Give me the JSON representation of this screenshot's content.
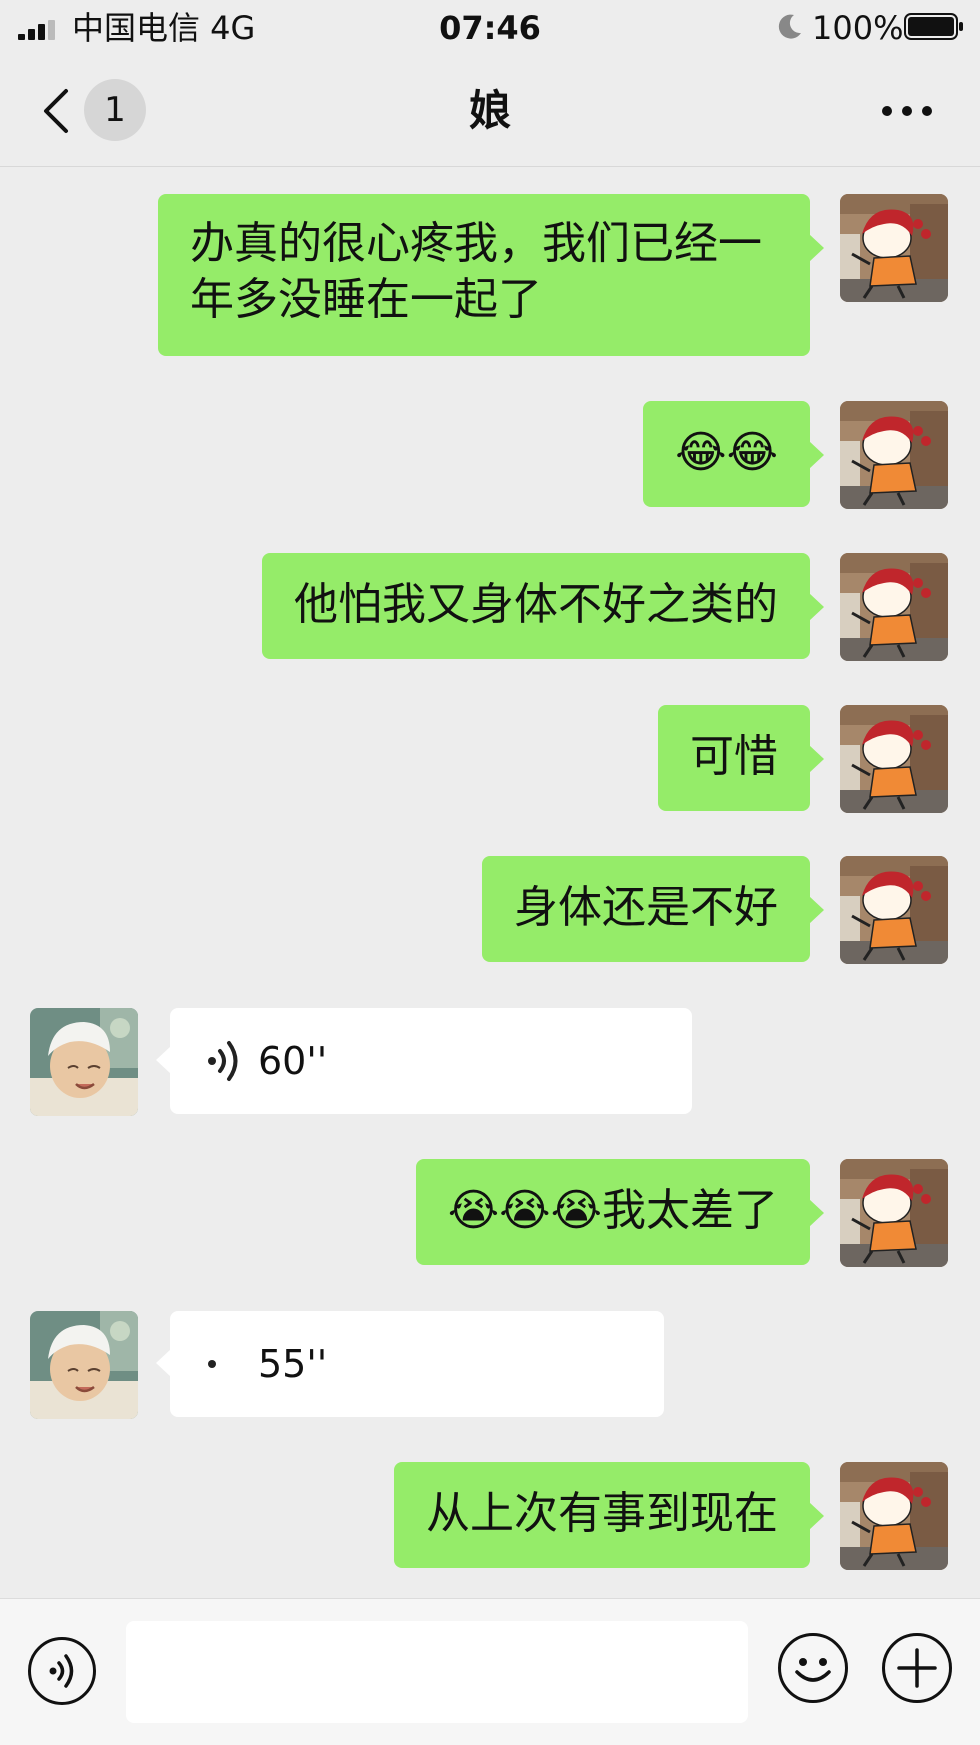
{
  "status_bar": {
    "carrier": "中国电信   4G",
    "time": "07:46",
    "battery_percent": "100%"
  },
  "nav": {
    "back_badge": "1",
    "title": "娘"
  },
  "messages": [
    {
      "side": "me",
      "type": "text",
      "text": "办真的很心疼我，我们已经一年多没睡在一起了"
    },
    {
      "side": "me",
      "type": "text",
      "text": "😂😂"
    },
    {
      "side": "me",
      "type": "text",
      "text": "他怕我又身体不好之类的"
    },
    {
      "side": "me",
      "type": "text",
      "text": "可惜"
    },
    {
      "side": "me",
      "type": "text",
      "text": "身体还是不好"
    },
    {
      "side": "other",
      "type": "voice",
      "duration": "60''"
    },
    {
      "side": "me",
      "type": "text",
      "text": "😭😭😭我太差了"
    },
    {
      "side": "other",
      "type": "voice",
      "duration": "55''"
    },
    {
      "side": "me",
      "type": "text",
      "text": "从上次有事到现在"
    }
  ],
  "input_bar": {
    "voice_button_icon": "voice-icon",
    "emoji_button_icon": "smiley-icon",
    "plus_button_icon": "plus-icon"
  }
}
